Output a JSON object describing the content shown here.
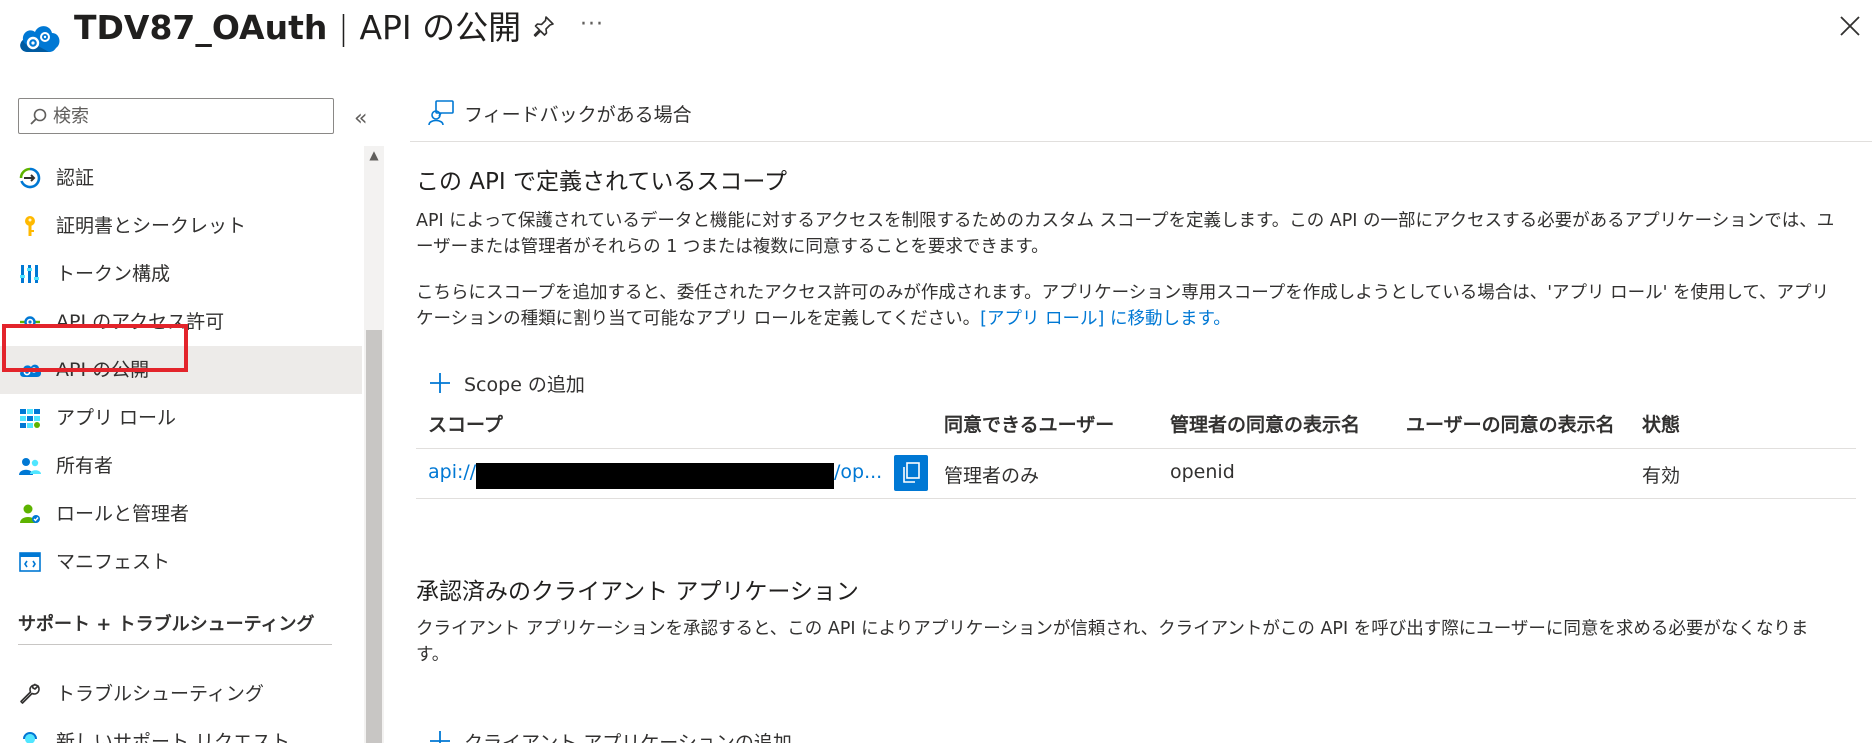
{
  "header": {
    "app_name": "TDV87_OAuth",
    "separator": " | ",
    "page_name": "API の公開",
    "more": "···"
  },
  "sidebar": {
    "search_placeholder": "検索",
    "collapse": "«",
    "items": [
      {
        "label": "認証",
        "icon": "authentication-icon"
      },
      {
        "label": "証明書とシークレット",
        "icon": "key-icon"
      },
      {
        "label": "トークン構成",
        "icon": "token-config-icon"
      },
      {
        "label": "API のアクセス許可",
        "icon": "api-permissions-icon"
      },
      {
        "label": "API の公開",
        "icon": "expose-api-icon",
        "active": true
      },
      {
        "label": "アプリ ロール",
        "icon": "app-roles-icon"
      },
      {
        "label": "所有者",
        "icon": "owners-icon"
      },
      {
        "label": "ロールと管理者",
        "icon": "roles-admins-icon"
      },
      {
        "label": "マニフェスト",
        "icon": "manifest-icon"
      }
    ],
    "support_section": "サポート + トラブルシューティング",
    "support_items": [
      {
        "label": "トラブルシューティング",
        "icon": "wrench-icon"
      },
      {
        "label": "新しいサポート リクエスト",
        "icon": "support-agent-icon"
      }
    ]
  },
  "main": {
    "feedback_label": "フィードバックがある場合",
    "scopes_title": "この API で定義されているスコープ",
    "scopes_desc": "API によって保護されているデータと機能に対するアクセスを制限するためのカスタム スコープを定義します。この API の一部にアクセスする必要があるアプリケーションでは、ユーザーまたは管理者がそれらの 1 つまたは複数に同意することを要求できます。",
    "scopes_note": "こちらにスコープを追加すると、委任されたアクセス許可のみが作成されます。アプリケーション専用スコープを作成しようとしている場合は、'アプリ ロール' を使用して、アプリケーションの種類に割り当て可能なアプリ ロールを定義してください。",
    "scopes_note_link": "[アプリ ロール] に移動します。",
    "add_scope_label": "Scope の追加",
    "table": {
      "headers": [
        "スコープ",
        "同意できるユーザー",
        "管理者の同意の表示名",
        "ユーザーの同意の表示名",
        "状態"
      ],
      "rows": [
        {
          "scope_prefix": "api://",
          "scope_suffix": "/op...",
          "who": "管理者のみ",
          "admin_name": "openid",
          "user_name": "",
          "state": "有効"
        }
      ]
    },
    "clients_title": "承認済みのクライアント アプリケーション",
    "clients_desc": "クライアント アプリケーションを承認すると、この API によりアプリケーションが信頼され、クライアントがこの API を呼び出す際にユーザーに同意を求める必要がなくなります。",
    "add_client_label": "クライアント アプリケーションの追加"
  },
  "colors": {
    "accent": "#0078d4",
    "highlight": "#e3242b",
    "active_bg": "#edebe9"
  }
}
